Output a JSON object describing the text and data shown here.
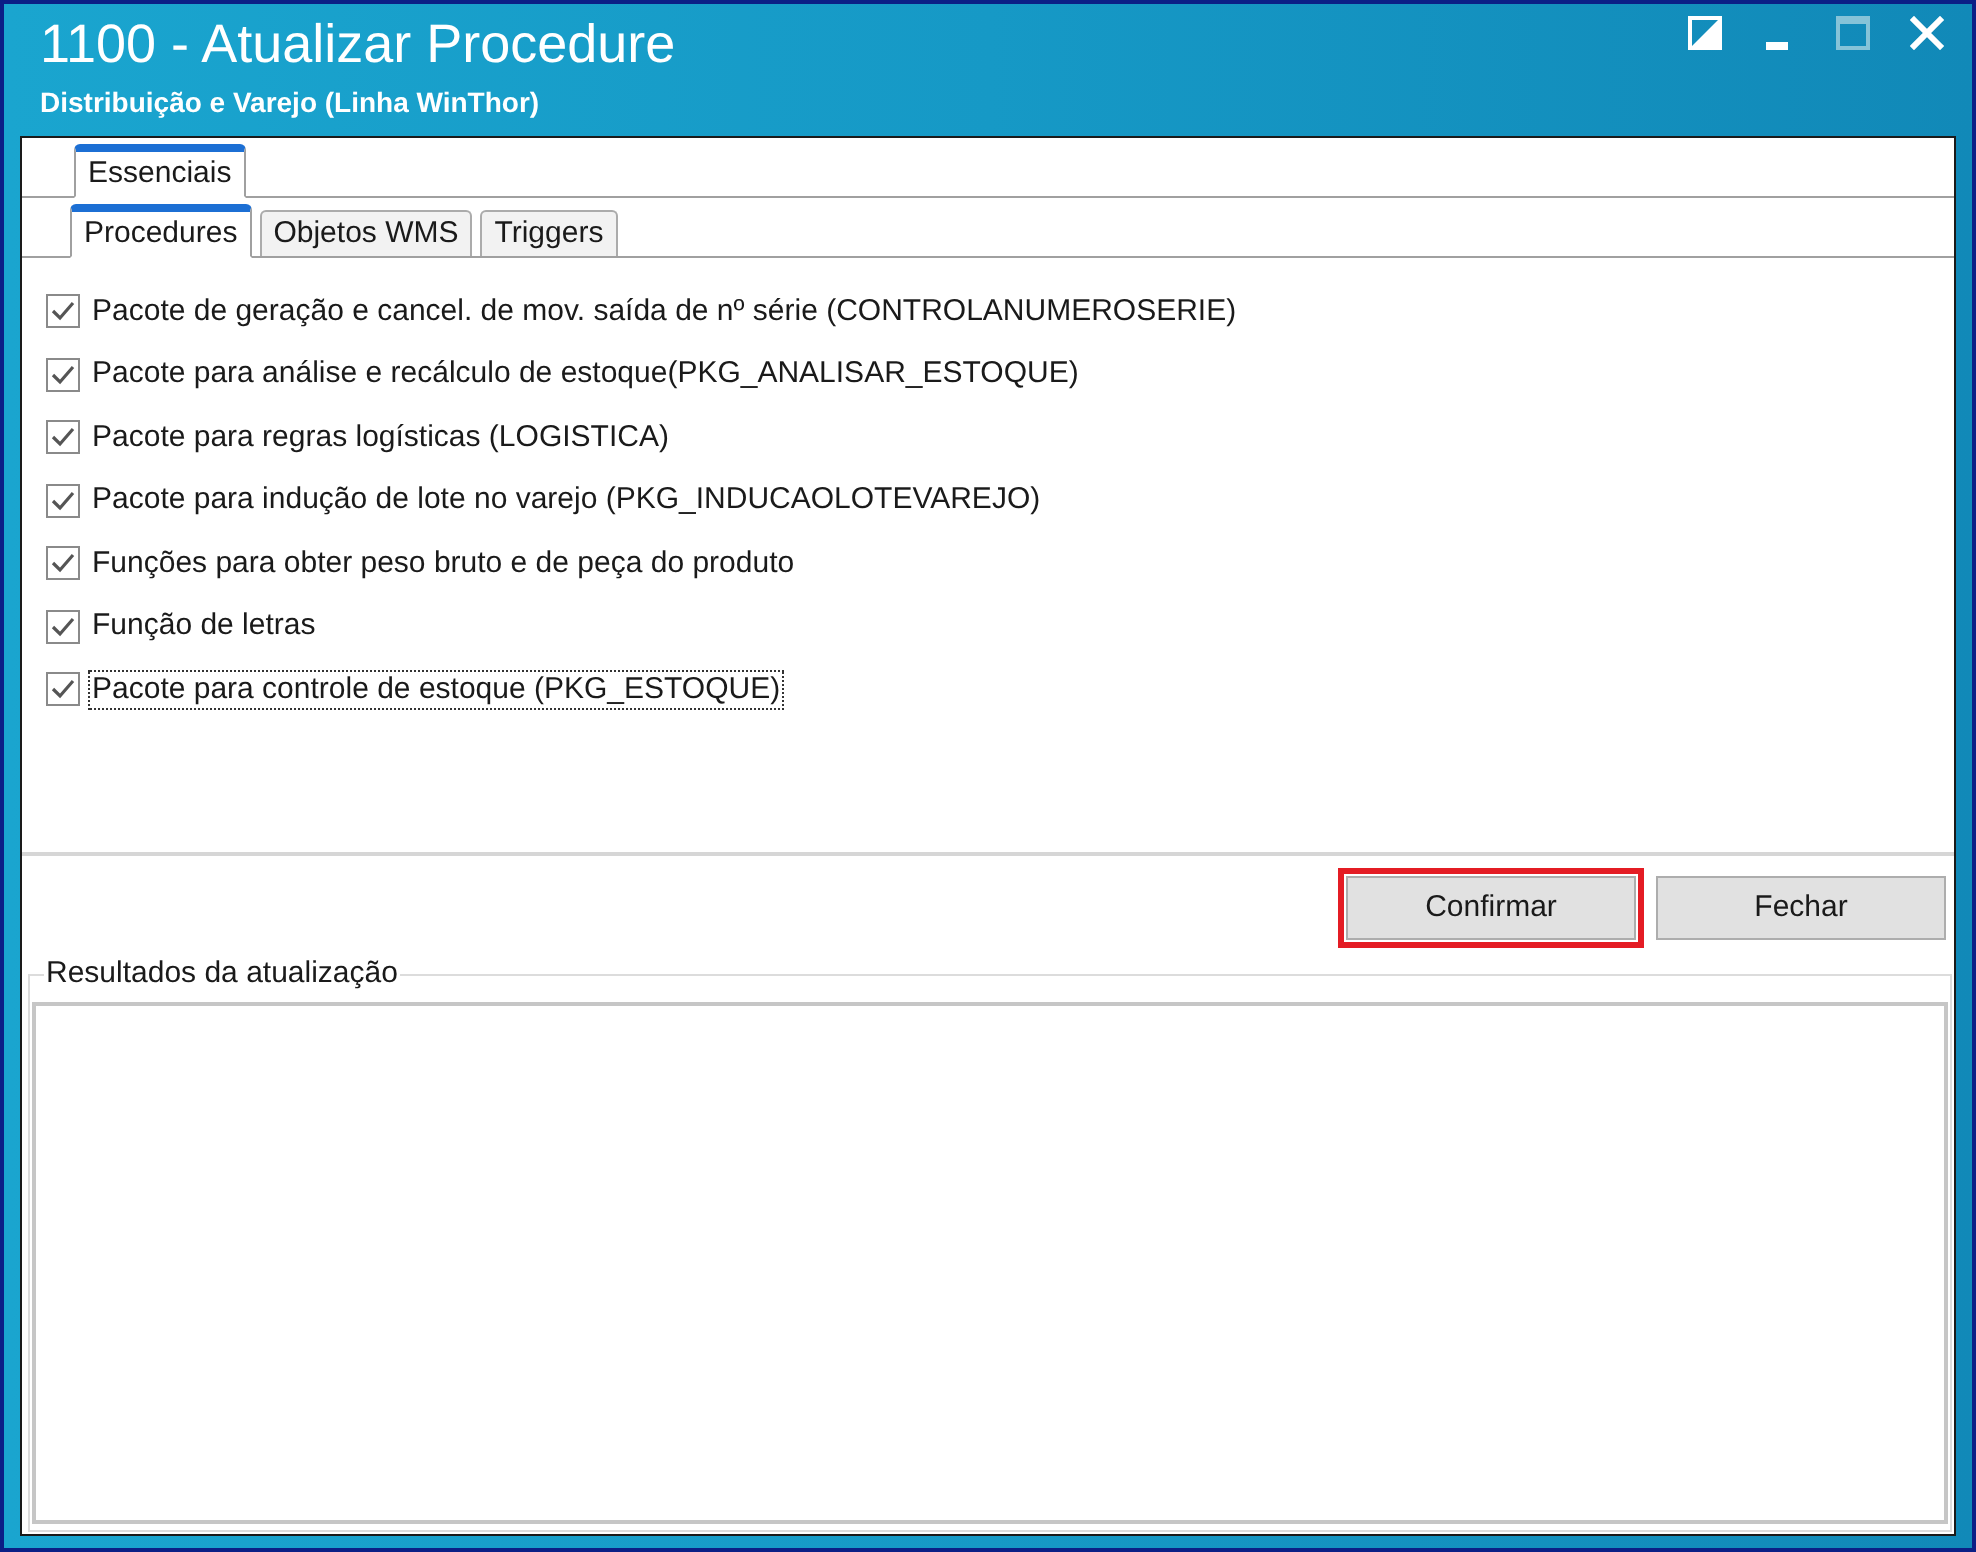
{
  "window": {
    "title": "1100 - Atualizar Procedure",
    "subtitle": "Distribuição e Varejo (Linha WinThor)",
    "controls": [
      {
        "kind": "contrast",
        "disabled": false
      },
      {
        "kind": "minimize",
        "disabled": false
      },
      {
        "kind": "maximize",
        "disabled": true
      },
      {
        "kind": "close",
        "disabled": false
      }
    ]
  },
  "category_tabs": [
    {
      "label": "Essenciais",
      "selected": true
    }
  ],
  "tabs": [
    {
      "label": "Procedures",
      "selected": true
    },
    {
      "label": "Objetos WMS",
      "selected": false
    },
    {
      "label": "Triggers",
      "selected": false
    }
  ],
  "procedures": [
    {
      "label": "Pacote de geração e cancel. de mov. saída de nº série (CONTROLANUMEROSERIE)",
      "checked": true,
      "focused": false
    },
    {
      "label": "Pacote para análise e recálculo de estoque(PKG_ANALISAR_ESTOQUE)",
      "checked": true,
      "focused": false
    },
    {
      "label": "Pacote para regras logísticas (LOGISTICA)",
      "checked": true,
      "focused": false
    },
    {
      "label": "Pacote para indução de lote no varejo (PKG_INDUCAOLOTEVAREJO)",
      "checked": true,
      "focused": false
    },
    {
      "label": "Funções para obter peso bruto e de peça do produto",
      "checked": true,
      "focused": false
    },
    {
      "label": "Função de letras",
      "checked": true,
      "focused": false
    },
    {
      "label": "Pacote para controle de estoque (PKG_ESTOQUE)",
      "checked": true,
      "focused": true
    }
  ],
  "buttons": [
    {
      "label": "Confirmar",
      "highlighted": true
    },
    {
      "label": "Fechar",
      "highlighted": false
    }
  ],
  "results": {
    "title": "Resultados da atualização"
  }
}
